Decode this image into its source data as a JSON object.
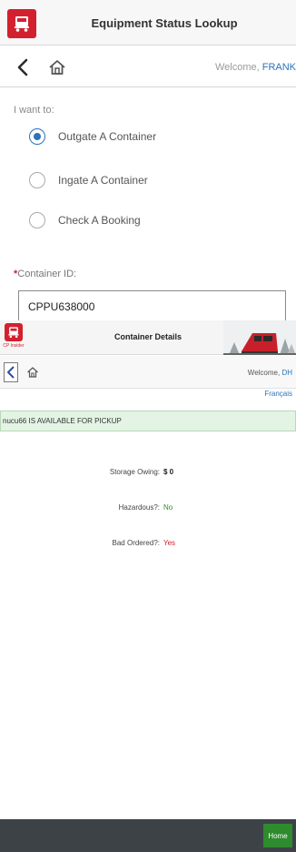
{
  "background_screen": {
    "header": {
      "title": "Equipment Status Lookup"
    },
    "nav": {
      "welcome_prefix": "Welcome, ",
      "user": "FRANK"
    },
    "form": {
      "prompt": "I want to:",
      "options": [
        {
          "label": "Outgate A Container",
          "checked": true
        },
        {
          "label": "Ingate A Container",
          "checked": false
        },
        {
          "label": "Check A Booking",
          "checked": false
        }
      ],
      "required_mark": "*",
      "container_id_label": "Container ID:",
      "container_id_value": "CPPU638000"
    }
  },
  "details_screen": {
    "header": {
      "title": "Container Details",
      "brand": "CP Insider"
    },
    "nav": {
      "welcome_prefix": "Welcome, ",
      "user": "DH"
    },
    "language_link": "Français",
    "alert": "nucu66 IS AVAILABLE FOR PICKUP",
    "fields": {
      "storage_owing_label": "Storage Owing:",
      "storage_owing_value": "$ 0",
      "hazardous_label": "Hazardous?:",
      "hazardous_value": "No",
      "bad_ordered_label": "Bad Ordered?:",
      "bad_ordered_value": "Yes"
    },
    "footer": {
      "home_button": "Home"
    }
  },
  "colors": {
    "brand_red": "#d3202f",
    "link_blue": "#2a74b9",
    "success_green": "#2e8b2e",
    "footer_dark": "#3d4247"
  },
  "icons": [
    "truck-logo-icon",
    "back-arrow-icon",
    "home-icon",
    "train-banner-icon"
  ]
}
